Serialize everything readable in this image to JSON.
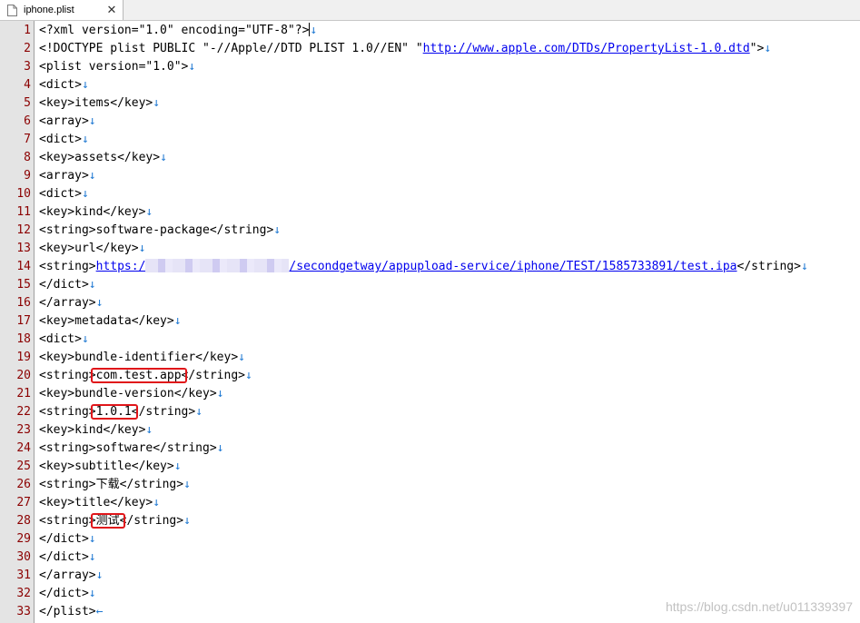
{
  "tab": {
    "filename": "iphone.plist",
    "close_glyph": "✕",
    "icon": "file-icon"
  },
  "eol_symbol": "↓",
  "last_eol_symbol": "←",
  "lines": [
    {
      "n": "1",
      "t": "<?xml version=\"1.0\" encoding=\"UTF-8\"?>"
    },
    {
      "n": "2",
      "t": "<!DOCTYPE plist PUBLIC \"-//Apple//DTD PLIST 1.0//EN\" \"",
      "link": "http://www.apple.com/DTDs/PropertyList-1.0.dtd",
      "t2": "\">"
    },
    {
      "n": "3",
      "t": "<plist version=\"1.0\">"
    },
    {
      "n": "4",
      "t": "<dict>"
    },
    {
      "n": "5",
      "t": "<key>items</key>"
    },
    {
      "n": "6",
      "t": "<array>"
    },
    {
      "n": "7",
      "t": "<dict>"
    },
    {
      "n": "8",
      "t": "<key>assets</key>"
    },
    {
      "n": "9",
      "t": "<array>"
    },
    {
      "n": "10",
      "t": "<dict>"
    },
    {
      "n": "11",
      "t": "<key>kind</key>"
    },
    {
      "n": "12",
      "t": "<string>software-package</string>"
    },
    {
      "n": "13",
      "t": "<key>url</key>"
    },
    {
      "n": "14",
      "t": "<string>",
      "link": "https:/",
      "blur": true,
      "link2": "/secondgetway/appupload-service/iphone/TEST/1585733891/test.ipa",
      "t2": "</string>"
    },
    {
      "n": "15",
      "t": "</dict>"
    },
    {
      "n": "16",
      "t": "</array>"
    },
    {
      "n": "17",
      "t": "<key>metadata</key>"
    },
    {
      "n": "18",
      "t": "<dict>"
    },
    {
      "n": "19",
      "t": "<key>bundle-identifier</key>"
    },
    {
      "n": "20",
      "t": "<string>com.test.app</string>"
    },
    {
      "n": "21",
      "t": "<key>bundle-version</key>"
    },
    {
      "n": "22",
      "t": "<string>1.0.1</string>"
    },
    {
      "n": "23",
      "t": "<key>kind</key>"
    },
    {
      "n": "24",
      "t": "<string>software</string>"
    },
    {
      "n": "25",
      "t": "<key>subtitle</key>"
    },
    {
      "n": "26",
      "t": "<string>下载</string>"
    },
    {
      "n": "27",
      "t": "<key>title</key>"
    },
    {
      "n": "28",
      "t": "<string>测试</string>"
    },
    {
      "n": "29",
      "t": "</dict>"
    },
    {
      "n": "30",
      "t": "</dict>"
    },
    {
      "n": "31",
      "t": "</array>"
    },
    {
      "n": "32",
      "t": "</dict>"
    },
    {
      "n": "33",
      "t": "</plist>"
    }
  ],
  "highlights": [
    {
      "line": "20",
      "value": "com.test.app"
    },
    {
      "line": "22",
      "value": "1.0.1"
    },
    {
      "line": "28",
      "value": "测试"
    }
  ],
  "watermark": "https://blog.csdn.net/u011339397",
  "colors": {
    "line_number": "#8b0000",
    "eol": "#1e78d2",
    "highlight": "#e0161a",
    "link": "#0000ee"
  }
}
